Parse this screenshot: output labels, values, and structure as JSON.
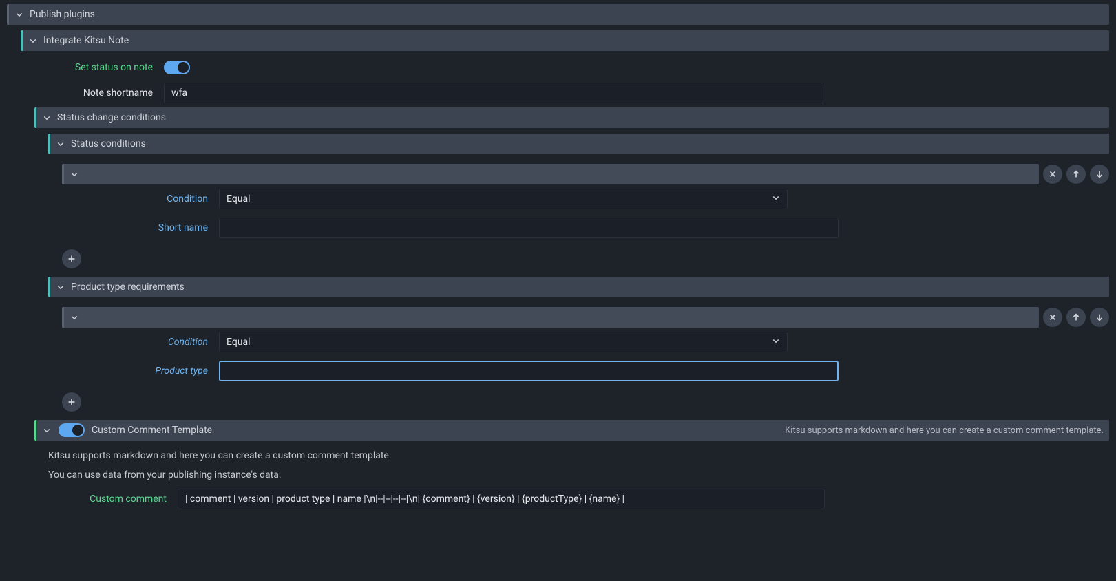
{
  "publish_plugins": {
    "title": "Publish plugins"
  },
  "integrate_kitsu_note": {
    "title": "Integrate Kitsu Note",
    "set_status_label": "Set status on note",
    "set_status_on": true,
    "note_shortname_label": "Note shortname",
    "note_shortname_value": "wfa"
  },
  "status_change_conditions": {
    "title": "Status change conditions"
  },
  "status_conditions": {
    "title": "Status conditions",
    "items": [
      {
        "condition_label": "Condition",
        "condition_value": "Equal",
        "short_name_label": "Short name",
        "short_name_value": ""
      }
    ]
  },
  "product_type_requirements": {
    "title": "Product type requirements",
    "items": [
      {
        "condition_label": "Condition",
        "condition_value": "Equal",
        "product_type_label": "Product type",
        "product_type_value": ""
      }
    ]
  },
  "custom_comment_template": {
    "title": "Custom Comment Template",
    "header_hint": "Kitsu supports markdown and here you can create a custom comment template.",
    "desc1": "Kitsu supports markdown and here you can create a custom comment template.",
    "desc2": "You can use data from your publishing instance's data.",
    "custom_comment_label": "Custom comment",
    "custom_comment_value": "| comment | version | product type | name |\\n|--|--|--|--|\\n| {comment} | {version} | {productType} | {name} |"
  }
}
